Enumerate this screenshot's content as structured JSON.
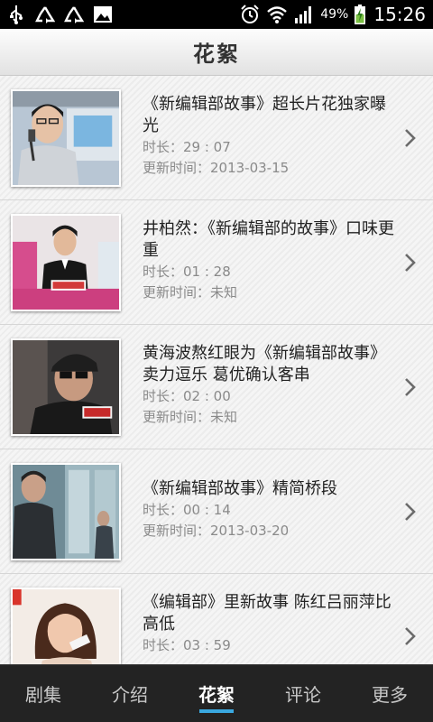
{
  "status_bar": {
    "icons_left": [
      "usb-icon",
      "recycle-icon",
      "recycle-icon",
      "image-icon"
    ],
    "icons_right": [
      "alarm-icon",
      "wifi-icon",
      "signal-icon"
    ],
    "battery": "49%",
    "time": "15:26"
  },
  "header": {
    "title": "花絮"
  },
  "clips": [
    {
      "title": "《新编辑部故事》超长片花独家曝光",
      "duration": "时长：29 : 07",
      "updated": "更新时间：2013-03-15"
    },
    {
      "title": "井柏然：《新编辑部的故事》口味更重",
      "duration": "时长：01 : 28",
      "updated": "更新时间：未知"
    },
    {
      "title": "黄海波熬红眼为《新编辑部故事》卖力逗乐 葛优确认客串",
      "duration": "时长：02 : 00",
      "updated": "更新时间：未知"
    },
    {
      "title": "《新编辑部故事》精简桥段",
      "duration": "时长：00 : 14",
      "updated": "更新时间：2013-03-20"
    },
    {
      "title": "《编辑部》里新故事 陈红吕丽萍比高低",
      "duration": "时长：03 : 59",
      "updated": ""
    }
  ],
  "tabs": [
    {
      "label": "剧集",
      "active": false
    },
    {
      "label": "介绍",
      "active": false
    },
    {
      "label": "花絮",
      "active": true
    },
    {
      "label": "评论",
      "active": false
    },
    {
      "label": "更多",
      "active": false
    }
  ],
  "colors": {
    "accent": "#3aa8e0",
    "tab_bar": "#232323",
    "status_bar": "#000000"
  }
}
